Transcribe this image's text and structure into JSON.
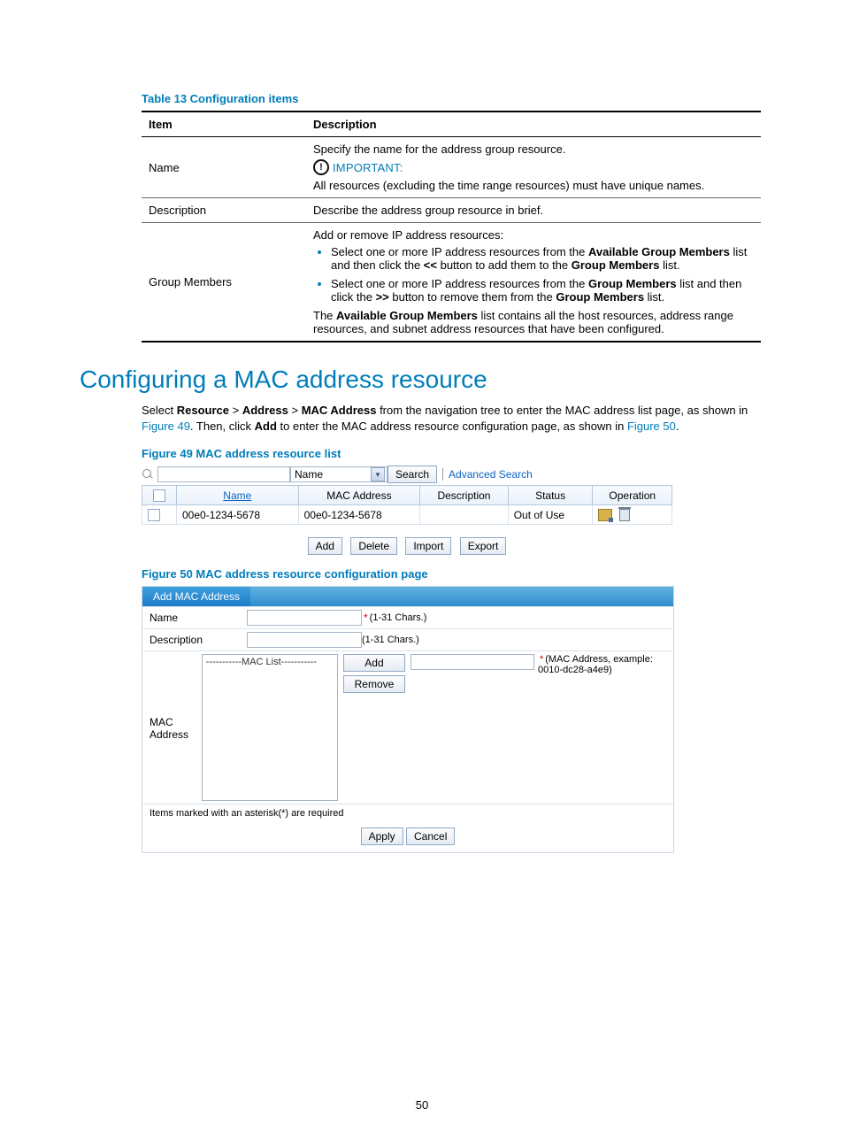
{
  "table13": {
    "caption": "Table 13 Configuration items",
    "headers": {
      "item": "Item",
      "desc": "Description"
    },
    "name_row": {
      "item": "Name",
      "line1": "Specify the name for the address group resource.",
      "important_label": "IMPORTANT:",
      "line2": "All resources (excluding the time range resources) must have unique names."
    },
    "desc_row": {
      "item": "Description",
      "text": "Describe the address group resource in brief."
    },
    "gm_row": {
      "item": "Group Members",
      "line1": "Add or remove IP address resources:",
      "b1_a": "Select one or more IP address resources from the ",
      "b1_b": "Available Group Members",
      "b1_c": " list and then click the ",
      "b1_d": "<<",
      "b1_e": " button to add them to the ",
      "b1_f": "Group Members",
      "b1_g": " list.",
      "b2_a": "Select one or more IP address resources from the ",
      "b2_b": "Group Members",
      "b2_c": " list and then click the ",
      "b2_d": ">>",
      "b2_e": " button to remove them from the ",
      "b2_f": "Group Members",
      "b2_g": " list.",
      "line2_a": "The ",
      "line2_b": "Available Group Members",
      "line2_c": " list contains all the host resources, address range resources, and subnet address resources that have been configured."
    }
  },
  "section": {
    "title": "Configuring a MAC address resource",
    "para_a": "Select ",
    "para_b": "Resource",
    "para_c": " > ",
    "para_d": "Address",
    "para_e": " > ",
    "para_f": "MAC Address",
    "para_g": " from the navigation tree to enter the MAC address list page, as shown in ",
    "para_h": "Figure 49",
    "para_i": ". Then, click ",
    "para_j": "Add",
    "para_k": " to enter the MAC address resource configuration page, as shown in ",
    "para_l": "Figure 50",
    "para_m": "."
  },
  "fig49": {
    "caption": "Figure 49 MAC address resource list",
    "filter_field": "Name",
    "search_btn": "Search",
    "adv": "Advanced Search",
    "cols": {
      "name": "Name",
      "mac": "MAC Address",
      "desc": "Description",
      "status": "Status",
      "op": "Operation"
    },
    "row": {
      "name": "00e0-1234-5678",
      "mac": "00e0-1234-5678",
      "desc": "",
      "status": "Out of Use"
    },
    "buttons": {
      "add": "Add",
      "del": "Delete",
      "imp": "Import",
      "exp": "Export"
    }
  },
  "fig50": {
    "caption": "Figure 50 MAC address resource configuration page",
    "tab": "Add MAC Address",
    "name_label": "Name",
    "name_hint": "(1-31 Chars.)",
    "desc_label": "Description",
    "desc_hint": "(1-31 Chars.)",
    "mac_label": "MAC Address",
    "list_hdr": "-----------MAC List-----------",
    "add_btn": "Add",
    "remove_btn": "Remove",
    "mac_hint": "(MAC Address, example: 0010-dc28-a4e9)",
    "required_note": "Items marked with an asterisk(*) are required",
    "apply": "Apply",
    "cancel": "Cancel"
  },
  "page_number": "50"
}
